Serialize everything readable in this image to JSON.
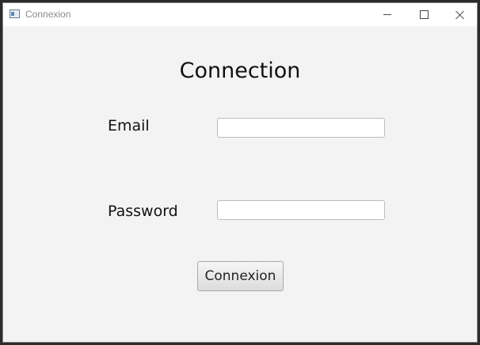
{
  "window": {
    "title": "Connexion",
    "controls": {
      "minimize_icon": "minimize-icon",
      "maximize_icon": "maximize-icon",
      "close_icon": "close-icon"
    }
  },
  "form": {
    "heading": "Connection",
    "email": {
      "label": "Email",
      "value": "",
      "placeholder": ""
    },
    "password": {
      "label": "Password",
      "value": "",
      "placeholder": ""
    },
    "submit_label": "Connexion"
  },
  "colors": {
    "window_background": "#f3f3f3",
    "titlebar_background": "#ffffff",
    "field_border": "#bdbdbd"
  }
}
